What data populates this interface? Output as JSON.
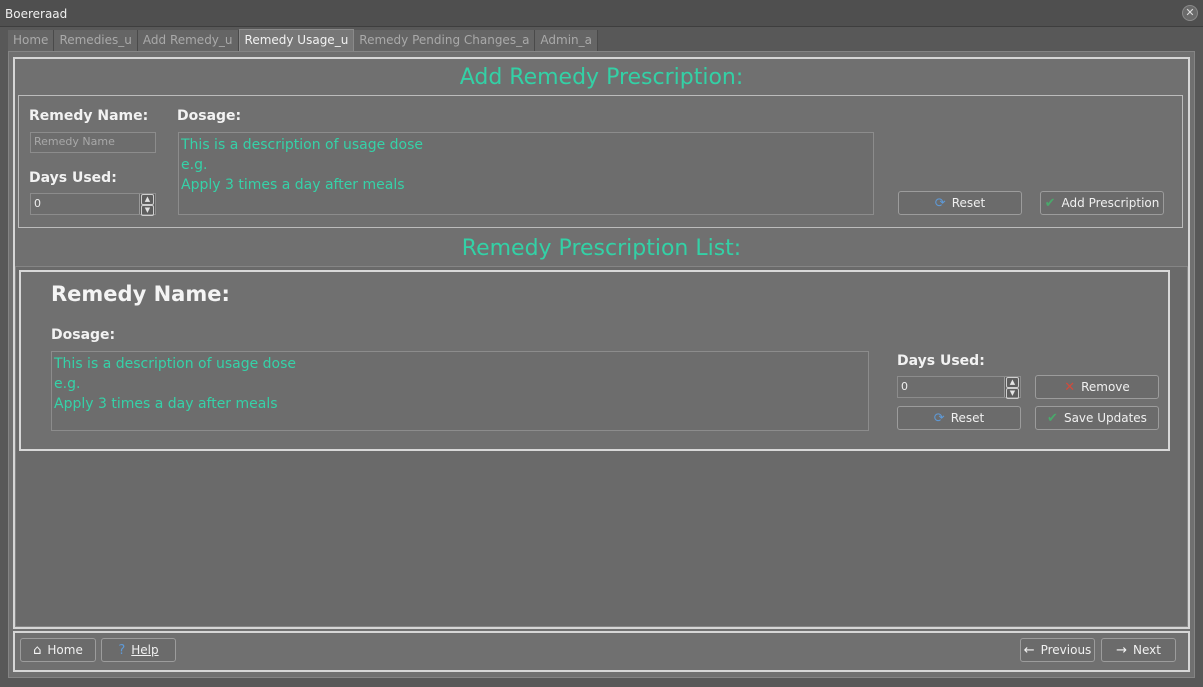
{
  "window": {
    "title": "Boereraad"
  },
  "tabs": [
    {
      "label": "Home"
    },
    {
      "label": "Remedies_u"
    },
    {
      "label": "Add Remedy_u"
    },
    {
      "label": "Remedy Usage_u"
    },
    {
      "label": "Remedy Pending Changes_a"
    },
    {
      "label": "Admin_a"
    }
  ],
  "active_tab": "Remedy Usage_u",
  "add_section": {
    "title": "Add Remedy Prescription:",
    "remedy_name_label": "Remedy Name:",
    "remedy_name_placeholder": "Remedy Name",
    "dosage_label": "Dosage:",
    "dosage_text": "This is a description of usage dose\ne.g.\nApply 3 times a day after meals",
    "days_used_label": "Days Used:",
    "days_used_value": "0",
    "reset_label": "Reset",
    "add_label": "Add Prescription"
  },
  "list_section": {
    "title": "Remedy Prescription List:",
    "items": [
      {
        "remedy_name_label": "Remedy Name:",
        "dosage_label": "Dosage:",
        "dosage_text": "This is a description of usage dose\ne.g.\nApply 3 times a day after meals",
        "days_used_label": "Days Used:",
        "days_used_value": "0",
        "remove_label": "Remove",
        "reset_label": "Reset",
        "save_label": "Save Updates"
      }
    ]
  },
  "footer": {
    "home_label": "Home",
    "help_label": "Help",
    "previous_label": "Previous",
    "next_label": "Next"
  },
  "icons": {
    "close": "close-icon",
    "reset": "refresh-icon",
    "add": "checkmark-icon",
    "remove": "x-icon",
    "save": "checkmark-icon",
    "home": "home-icon",
    "help": "question-icon",
    "previous": "arrow-left-icon",
    "next": "arrow-right-icon"
  },
  "colors": {
    "accent": "#33d1a6",
    "background": "#707070"
  }
}
